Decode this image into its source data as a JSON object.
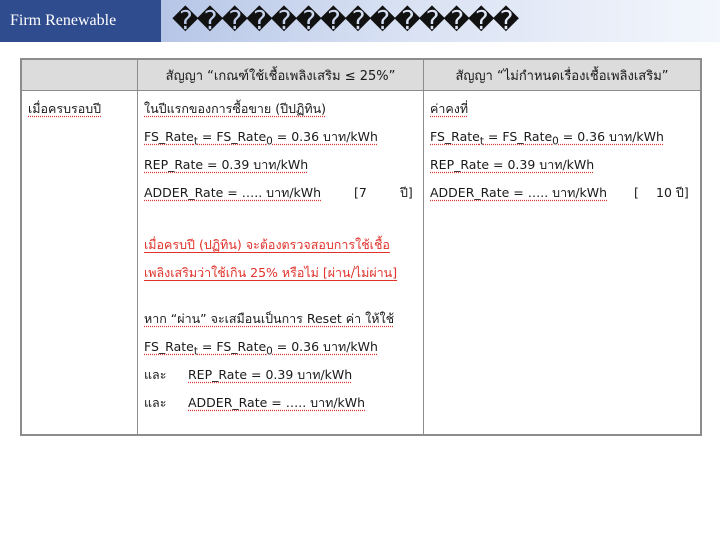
{
  "header": {
    "brand": "Firm Renewable",
    "title": "��������������"
  },
  "table": {
    "col_headers": [
      "",
      "สัญญา “เกณฑ์ใช้เชื้อเพลิงเสริม ≤ 25%”",
      "สัญญา “ไม่กำหนดเรื่องเชื้อเพลิงเสริม”"
    ],
    "row_label": "เมื่อครบรอบปี",
    "col1": {
      "intro": "ในปีแรกของการซื้อขาย (ปีปฏิทิน)",
      "fs_rate": "FS_Rate",
      "fs_sub": "t",
      "fs_eq": " = FS_Rate",
      "fs_sub0": "0",
      "fs_val": " = 0.36 บาท/kWh",
      "rep_rate": "REP_Rate = 0.39 บาท/kWh",
      "adder_rate": "ADDER_Rate = ….. บาท/kWh",
      "adder_years_open": "[7",
      "adder_years_unit": "ปี]",
      "red_line1": "เมื่อครบปี (ปฏิทิน) จะต้องตรวจสอบการใช้เชื้อ",
      "red_line2": "เพลิงเสริมว่าใช้เกิน 25% หรือไม่ [ผ่าน/ไม่ผ่าน]",
      "pass_line": "หาก “ผ่าน” จะเสมือนเป็นการ Reset ค่า ให้ใช้",
      "fs_val2": " = 0.36 บาท/kWh",
      "and1": "และ",
      "rep_rate2": "REP_Rate = 0.39 บาท/kWh",
      "and2": "และ",
      "adder_rate2": "ADDER_Rate = ….. บาท/kWh"
    },
    "col2": {
      "intro": "ค่าคงที่",
      "fs_rate": "FS_Rate",
      "fs_sub": "t",
      "fs_eq": " = FS_Rate",
      "fs_sub0": "0",
      "fs_val": " = 0.36 บาท/kWh",
      "rep_rate": "REP_Rate = 0.39 บาท/kWh",
      "adder_rate": "ADDER_Rate = ….. บาท/kWh",
      "adder_years_open": "[",
      "adder_years_unit": "10 ปี]"
    }
  }
}
